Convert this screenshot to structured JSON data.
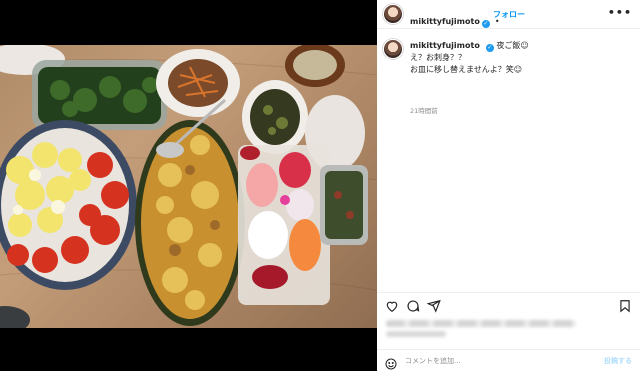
{
  "post": {
    "username": "mikittyfujimoto",
    "verified_mark": "✓",
    "separator": "•",
    "follow_label": "フォロー",
    "more_icon": "•••"
  },
  "caption": {
    "username": "mikittyfujimoto",
    "line1": "夜ご飯☺︎",
    "line2": "え？お刺身？？",
    "line3": "お皿に移し替えませんよ？笑☺︎",
    "timestamp": "21時間前"
  },
  "actions": {
    "icons": [
      "heart-icon",
      "comment-icon",
      "share-icon",
      "bookmark-icon"
    ]
  },
  "comment": {
    "placeholder": "コメントを追加...",
    "post_label": "投稿する",
    "emoji_icon": "smiley-icon"
  },
  "colors": {
    "accent": "#0095f6",
    "verified": "#1d9bf0",
    "text": "#262626",
    "muted": "#8e8e8e"
  }
}
